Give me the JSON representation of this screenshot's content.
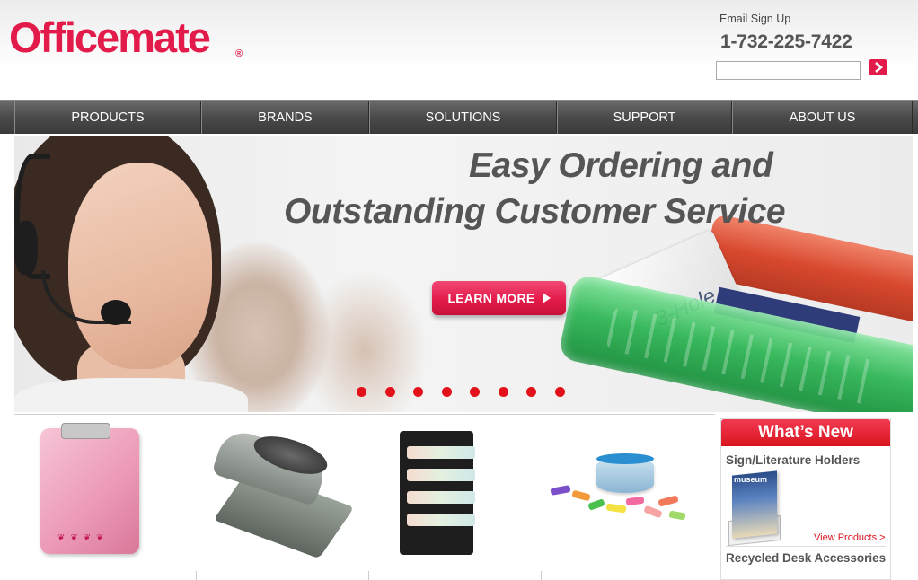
{
  "brand": {
    "logo_text": "Officemate",
    "registered_mark": "®",
    "accent_color": "#e31b4a"
  },
  "header": {
    "email_signup_label": "Email Sign Up",
    "phone": "1-732-225-7422",
    "email_input_value": "",
    "submit_icon": "chevron-right-icon"
  },
  "nav": {
    "items": [
      {
        "label": "PRODUCTS"
      },
      {
        "label": "BRANDS"
      },
      {
        "label": "SOLUTIONS"
      },
      {
        "label": "SUPPORT"
      },
      {
        "label": "ABOUT US"
      }
    ]
  },
  "hero": {
    "headline_line1": "Easy Ordering and",
    "headline_line2": "Outstanding Customer Service",
    "cta_label": "LEARN MORE",
    "cta_icon": "play-arrow-icon",
    "product_text": "3-Hole",
    "slide_count": 8
  },
  "products": [
    {
      "name": "clipboard",
      "icon": "pink-clipboard"
    },
    {
      "name": "hole-punch",
      "icon": "three-hole-punch"
    },
    {
      "name": "wall-file",
      "icon": "wall-file-organizer"
    },
    {
      "name": "erasers",
      "icon": "eraser-tub"
    }
  ],
  "whats_new": {
    "title": "What’s New",
    "item1_title": "Sign/Literature Holders",
    "item1_image_text": "museum",
    "view_products": "View Products >",
    "item2_title": "Recycled Desk Accessories"
  }
}
